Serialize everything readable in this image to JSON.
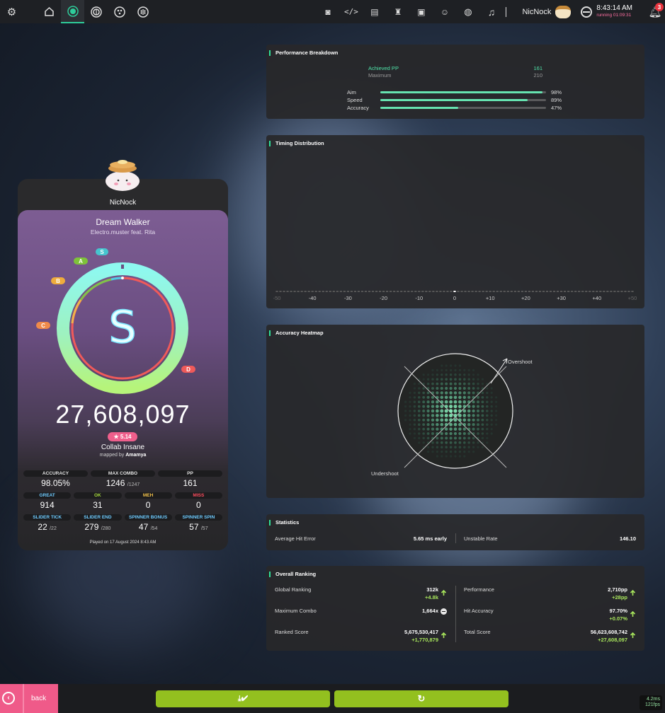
{
  "toolbar": {
    "user_name": "NicNock",
    "clock_time": "8:43:14 AM",
    "running_time": "running 01:09:31",
    "notification_count": "3"
  },
  "score": {
    "player_name": "NicNock",
    "song_title": "Dream Walker",
    "song_artist": "Electro.muster feat. Rita",
    "rank": "S",
    "rank_markers": [
      "S",
      "A",
      "B",
      "C",
      "D"
    ],
    "accuracy_fraction": 0.9805,
    "total_score": "27,608,097",
    "star_rating": "★ 5.14",
    "difficulty": "Collab Insane",
    "mapped_by_prefix": "mapped by",
    "mapper": "Amamya",
    "played_on": "Played on 17 August 2024 8:43 AM",
    "stats_top": [
      {
        "label": "ACCURACY",
        "value": "98.05%",
        "suffix": ""
      },
      {
        "label": "MAX COMBO",
        "value": "1246",
        "suffix": "/1247"
      },
      {
        "label": "PP",
        "value": "161",
        "suffix": ""
      }
    ],
    "stats_judgements": [
      {
        "label": "GREAT",
        "value": "914",
        "color": "#6ecbff"
      },
      {
        "label": "OK",
        "value": "31",
        "color": "#a5d93c"
      },
      {
        "label": "MEH",
        "value": "0",
        "color": "#f2c14a"
      },
      {
        "label": "MISS",
        "value": "0",
        "color": "#ff4d5e"
      }
    ],
    "stats_ticks": [
      {
        "label": "SLIDER TICK",
        "value": "22",
        "suffix": "/22"
      },
      {
        "label": "SLIDER END",
        "value": "279",
        "suffix": "/280"
      },
      {
        "label": "SPINNER BONUS",
        "value": "47",
        "suffix": "/54"
      },
      {
        "label": "SPINNER SPIN",
        "value": "57",
        "suffix": "/57"
      }
    ]
  },
  "performance": {
    "title": "Performance Breakdown",
    "achieved_label": "Achieved PP",
    "achieved_value": "161",
    "maximum_label": "Maximum",
    "maximum_value": "210",
    "bars": [
      {
        "label": "Aim",
        "value": "98%",
        "fraction": 0.98
      },
      {
        "label": "Speed",
        "value": "89%",
        "fraction": 0.89
      },
      {
        "label": "Accuracy",
        "value": "47%",
        "fraction": 0.47
      }
    ]
  },
  "timing": {
    "title": "Timing Distribution"
  },
  "chart_data": {
    "type": "bar",
    "title": "Timing Distribution",
    "x": [
      -50,
      -49,
      -48,
      -47,
      -46,
      -45,
      -44,
      -43,
      -42,
      -41,
      -40,
      -39,
      -38,
      -37,
      -36,
      -35,
      -34,
      -33,
      -32,
      -31,
      -30,
      -29,
      -28,
      -27,
      -26,
      -25,
      -24,
      -23,
      -22,
      -21,
      -20,
      -19,
      -18,
      -17,
      -16,
      -15,
      -14,
      -13,
      -12,
      -11,
      -10,
      -9,
      -8,
      -7,
      -6,
      -5,
      -4,
      -3,
      -2,
      -1,
      0,
      1,
      2,
      3,
      4,
      5,
      6,
      7,
      8,
      9,
      10,
      11,
      12,
      13,
      14,
      15,
      16,
      17,
      18,
      19,
      20,
      21,
      22,
      23,
      24,
      25,
      26,
      27,
      28,
      29,
      30,
      31,
      32,
      33,
      34,
      35,
      36,
      37,
      38,
      39,
      40,
      41,
      42,
      43,
      44,
      45,
      46,
      47,
      48,
      49,
      50
    ],
    "values": [
      0,
      0,
      0,
      0,
      0,
      0,
      0,
      0,
      0,
      0,
      0,
      0,
      0,
      0,
      0,
      0,
      0,
      0,
      0,
      0,
      0,
      0,
      0,
      0,
      0,
      0,
      0,
      0,
      0,
      0,
      0,
      0,
      0,
      0,
      0,
      0,
      0,
      0,
      0,
      0,
      0,
      0,
      0,
      0,
      0,
      0,
      0,
      0,
      0,
      0,
      0,
      0,
      0,
      0,
      0,
      0,
      0,
      0,
      0,
      0,
      0,
      0,
      0,
      0,
      0,
      0,
      0,
      0,
      0,
      0,
      0,
      0,
      0,
      0,
      0,
      0,
      0,
      0,
      0,
      0,
      0,
      0,
      0,
      0,
      0,
      0,
      0,
      0,
      0,
      0,
      0,
      0,
      0,
      0,
      0,
      0,
      0,
      0,
      0,
      0,
      0
    ],
    "x_ticks": [
      "-50",
      "-40",
      "-30",
      "-20",
      "-10",
      "0",
      "+10",
      "+20",
      "+30",
      "+40",
      "+50"
    ],
    "xlim": [
      -50,
      50
    ],
    "colors": {
      "great": "#5ab8ef",
      "ok": "#86b71b",
      "zero": "#ffffff",
      "empty": "#555555"
    }
  },
  "heatmap": {
    "title": "Accuracy Heatmap",
    "overshoot_label": "Overshoot",
    "undershoot_label": "Undershoot"
  },
  "statistics": {
    "title": "Statistics",
    "avg_hit_error_label": "Average Hit Error",
    "avg_hit_error_value": "5.65 ms early",
    "unstable_rate_label": "Unstable Rate",
    "unstable_rate_value": "146.10"
  },
  "ranking": {
    "title": "Overall Ranking",
    "items": [
      {
        "label": "Global Ranking",
        "value": "312k",
        "delta": "+4.8k",
        "trend": "up"
      },
      {
        "label": "Performance",
        "value": "2,710pp",
        "delta": "+28pp",
        "trend": "up"
      },
      {
        "label": "Maximum Combo",
        "value": "1,664x",
        "delta": "",
        "trend": "same"
      },
      {
        "label": "Hit Accuracy",
        "value": "97.70%",
        "delta": "+0.07%",
        "trend": "up"
      },
      {
        "label": "Ranked Score",
        "value": "5,675,530,417",
        "delta": "+1,770,879",
        "trend": "up"
      },
      {
        "label": "Total Score",
        "value": "56,623,608,742",
        "delta": "+27,608,097",
        "trend": "up"
      }
    ]
  },
  "bottom": {
    "back_label": "back",
    "frame_time": "4.2ms",
    "fps": "121fps"
  }
}
